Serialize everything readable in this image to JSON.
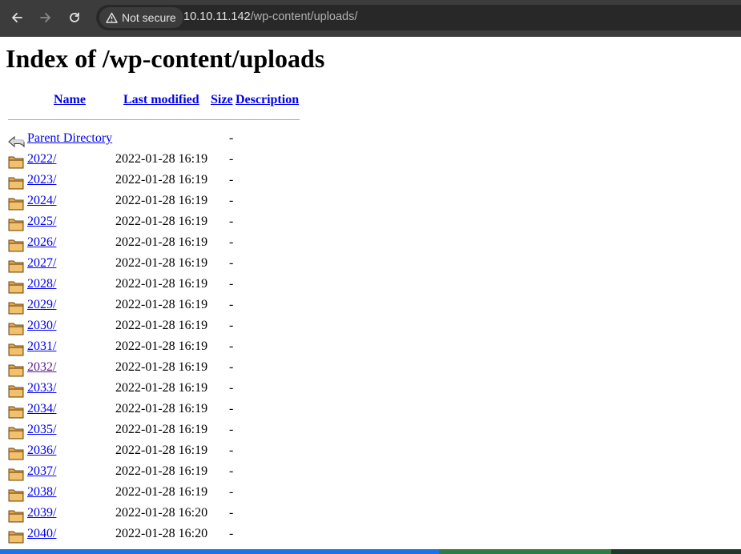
{
  "browser": {
    "security_label": "Not secure",
    "url_host": "10.10.11.142",
    "url_path": "/wp-content/uploads/"
  },
  "page": {
    "title": "Index of /wp-content/uploads",
    "columns": {
      "name": "Name",
      "last_modified": "Last modified",
      "size": "Size",
      "description": "Description"
    },
    "parent": {
      "name": "Parent Directory",
      "size": "-"
    },
    "rows": [
      {
        "name": "2022/",
        "modified": "2022-01-28 16:19",
        "size": "-"
      },
      {
        "name": "2023/",
        "modified": "2022-01-28 16:19",
        "size": "-"
      },
      {
        "name": "2024/",
        "modified": "2022-01-28 16:19",
        "size": "-"
      },
      {
        "name": "2025/",
        "modified": "2022-01-28 16:19",
        "size": "-"
      },
      {
        "name": "2026/",
        "modified": "2022-01-28 16:19",
        "size": "-"
      },
      {
        "name": "2027/",
        "modified": "2022-01-28 16:19",
        "size": "-"
      },
      {
        "name": "2028/",
        "modified": "2022-01-28 16:19",
        "size": "-"
      },
      {
        "name": "2029/",
        "modified": "2022-01-28 16:19",
        "size": "-"
      },
      {
        "name": "2030/",
        "modified": "2022-01-28 16:19",
        "size": "-"
      },
      {
        "name": "2031/",
        "modified": "2022-01-28 16:19",
        "size": "-"
      },
      {
        "name": "2032/",
        "modified": "2022-01-28 16:19",
        "size": "-",
        "visited": true
      },
      {
        "name": "2033/",
        "modified": "2022-01-28 16:19",
        "size": "-"
      },
      {
        "name": "2034/",
        "modified": "2022-01-28 16:19",
        "size": "-"
      },
      {
        "name": "2035/",
        "modified": "2022-01-28 16:19",
        "size": "-"
      },
      {
        "name": "2036/",
        "modified": "2022-01-28 16:19",
        "size": "-"
      },
      {
        "name": "2037/",
        "modified": "2022-01-28 16:19",
        "size": "-"
      },
      {
        "name": "2038/",
        "modified": "2022-01-28 16:19",
        "size": "-"
      },
      {
        "name": "2039/",
        "modified": "2022-01-28 16:20",
        "size": "-"
      },
      {
        "name": "2040/",
        "modified": "2022-01-28 16:20",
        "size": "-"
      }
    ]
  },
  "colors": {
    "link": "#0000ee",
    "visited_link": "#551a8b",
    "toolbar": "#3c3c3c",
    "omnibox": "#282828"
  },
  "icons": {
    "back": "arrow-left-icon",
    "forward": "arrow-right-icon",
    "reload": "reload-icon",
    "security": "warning-triangle-icon",
    "parent": "back-arrow-icon",
    "folder": "folder-icon"
  }
}
